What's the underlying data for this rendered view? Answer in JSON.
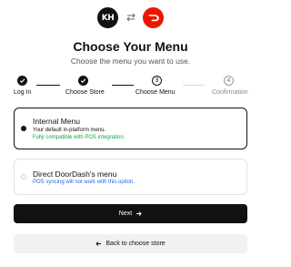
{
  "header": {
    "kh_logo_text": "KH",
    "title": "Choose Your Menu",
    "subtitle": "Choose the menu you want to use."
  },
  "stepper": {
    "steps": [
      {
        "label": "Log In",
        "status": "done",
        "number": ""
      },
      {
        "label": "Choose Store",
        "status": "done",
        "number": ""
      },
      {
        "label": "Choose Menu",
        "status": "current",
        "number": "3"
      },
      {
        "label": "Confirmation",
        "status": "upcoming",
        "number": "4"
      }
    ]
  },
  "options": [
    {
      "title": "Internal Menu",
      "description": "Your default in-platform menu.",
      "note": "Fully compatible with POS integration.",
      "selected": true
    },
    {
      "title": "Direct DoorDash's menu",
      "description": "",
      "note": "POS syncing will not work with this option.",
      "selected": false
    }
  ],
  "actions": {
    "next_label": "Next",
    "back_label": "Back to choose store"
  },
  "colors": {
    "primary": "#111111",
    "doordash_red": "#eb1700",
    "success_green": "#16a34a",
    "info_blue": "#2563eb"
  }
}
